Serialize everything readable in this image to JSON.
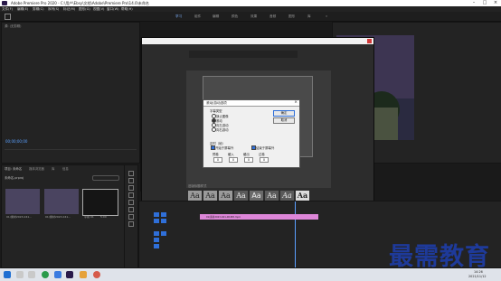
{
  "window": {
    "title": "Adobe Premiere Pro 2020 - C:\\用户\\Ebsy\\文档\\Adobe\\Premiere Pro\\14.0\\未命名"
  },
  "menu": [
    "文件(F)",
    "编辑(E)",
    "剪辑(C)",
    "序列(S)",
    "标记(M)",
    "图形(G)",
    "视图(V)",
    "窗口(W)",
    "帮助(H)"
  ],
  "workspaces": [
    "学习",
    "组件",
    "编辑",
    "颜色",
    "效果",
    "音频",
    "图形",
    "库"
  ],
  "active_workspace": "学习",
  "source": {
    "timecode": "00;00;00;00"
  },
  "program": {
    "timecode": "00;00;00;00"
  },
  "project": {
    "tabs": [
      "项目: 未命名",
      "媒体浏览器",
      "库",
      "信息"
    ],
    "name": "未命名.prproj"
  },
  "media": [
    {
      "label": "01/素材2023-041...",
      "duration": "4:29"
    },
    {
      "label": "01/素材2023-041...",
      "duration": "4:29"
    },
    {
      "label": "字幕 01",
      "duration": "5:00"
    }
  ],
  "dialog": {
    "title": "滚动/游动选项",
    "group_title": "字幕类型",
    "options": [
      "静止图像",
      "滚动",
      "向左游动",
      "向右游动"
    ],
    "selected_option": "滚动",
    "timing_label": "定时（帧）",
    "checkboxes": [
      {
        "label": "开始于屏幕外",
        "checked": true
      },
      {
        "label": "结束于屏幕外",
        "checked": true
      }
    ],
    "fields": [
      "预卷",
      "缓入",
      "缓出",
      "过卷"
    ],
    "field_values": [
      "0",
      "0",
      "0",
      "0"
    ],
    "ok": "确定",
    "cancel": "取消"
  },
  "styles_label": "旧版标题样式",
  "font_samples": [
    "Aa",
    "Aa",
    "Aa",
    "Aa",
    "Aa",
    "Aa",
    "Aa",
    "Aa",
    "Aa"
  ],
  "timeline": {
    "clip": "01/素材2023-041-00483.mp4"
  },
  "taskbar": {
    "time": "14:26",
    "date": "2021/11/12"
  },
  "watermark": "最需教育",
  "colors": {
    "accent": "#2f6fd8",
    "clip": "#dd86d8",
    "timecode": "#5aa0ff",
    "watermark": "#1e3a9a",
    "close": "#d23a3a"
  }
}
